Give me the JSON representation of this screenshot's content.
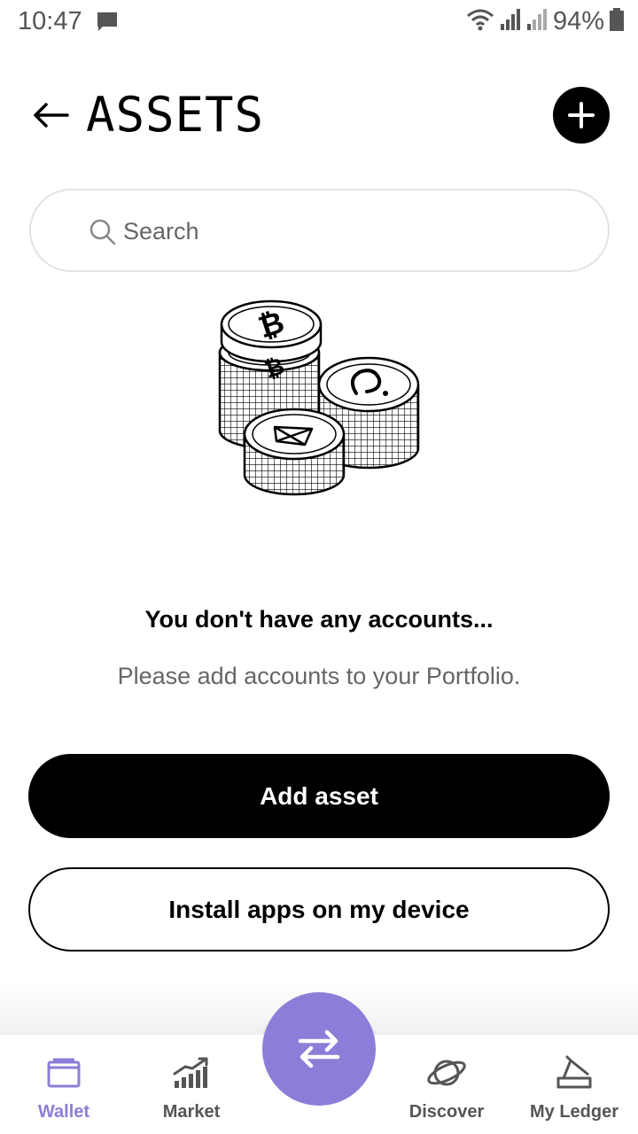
{
  "status_bar": {
    "time": "10:47",
    "battery": "94%"
  },
  "header": {
    "title": "ASSETS"
  },
  "search": {
    "placeholder": "Search"
  },
  "empty_state": {
    "title": "You don't have any accounts...",
    "subtitle": "Please add accounts to your Portfolio."
  },
  "actions": {
    "add_asset": "Add asset",
    "install_apps": "Install apps on my device"
  },
  "nav": {
    "items": [
      {
        "label": "Wallet",
        "icon": "wallet-icon",
        "active": true
      },
      {
        "label": "Market",
        "icon": "chart-icon",
        "active": false
      },
      {
        "label": "Discover",
        "icon": "planet-icon",
        "active": false
      },
      {
        "label": "My Ledger",
        "icon": "ledger-device-icon",
        "active": false
      }
    ],
    "center_icon": "transfer-icon"
  },
  "colors": {
    "accent": "#8c7ed8",
    "primary": "#000000",
    "muted_text": "#666666"
  }
}
